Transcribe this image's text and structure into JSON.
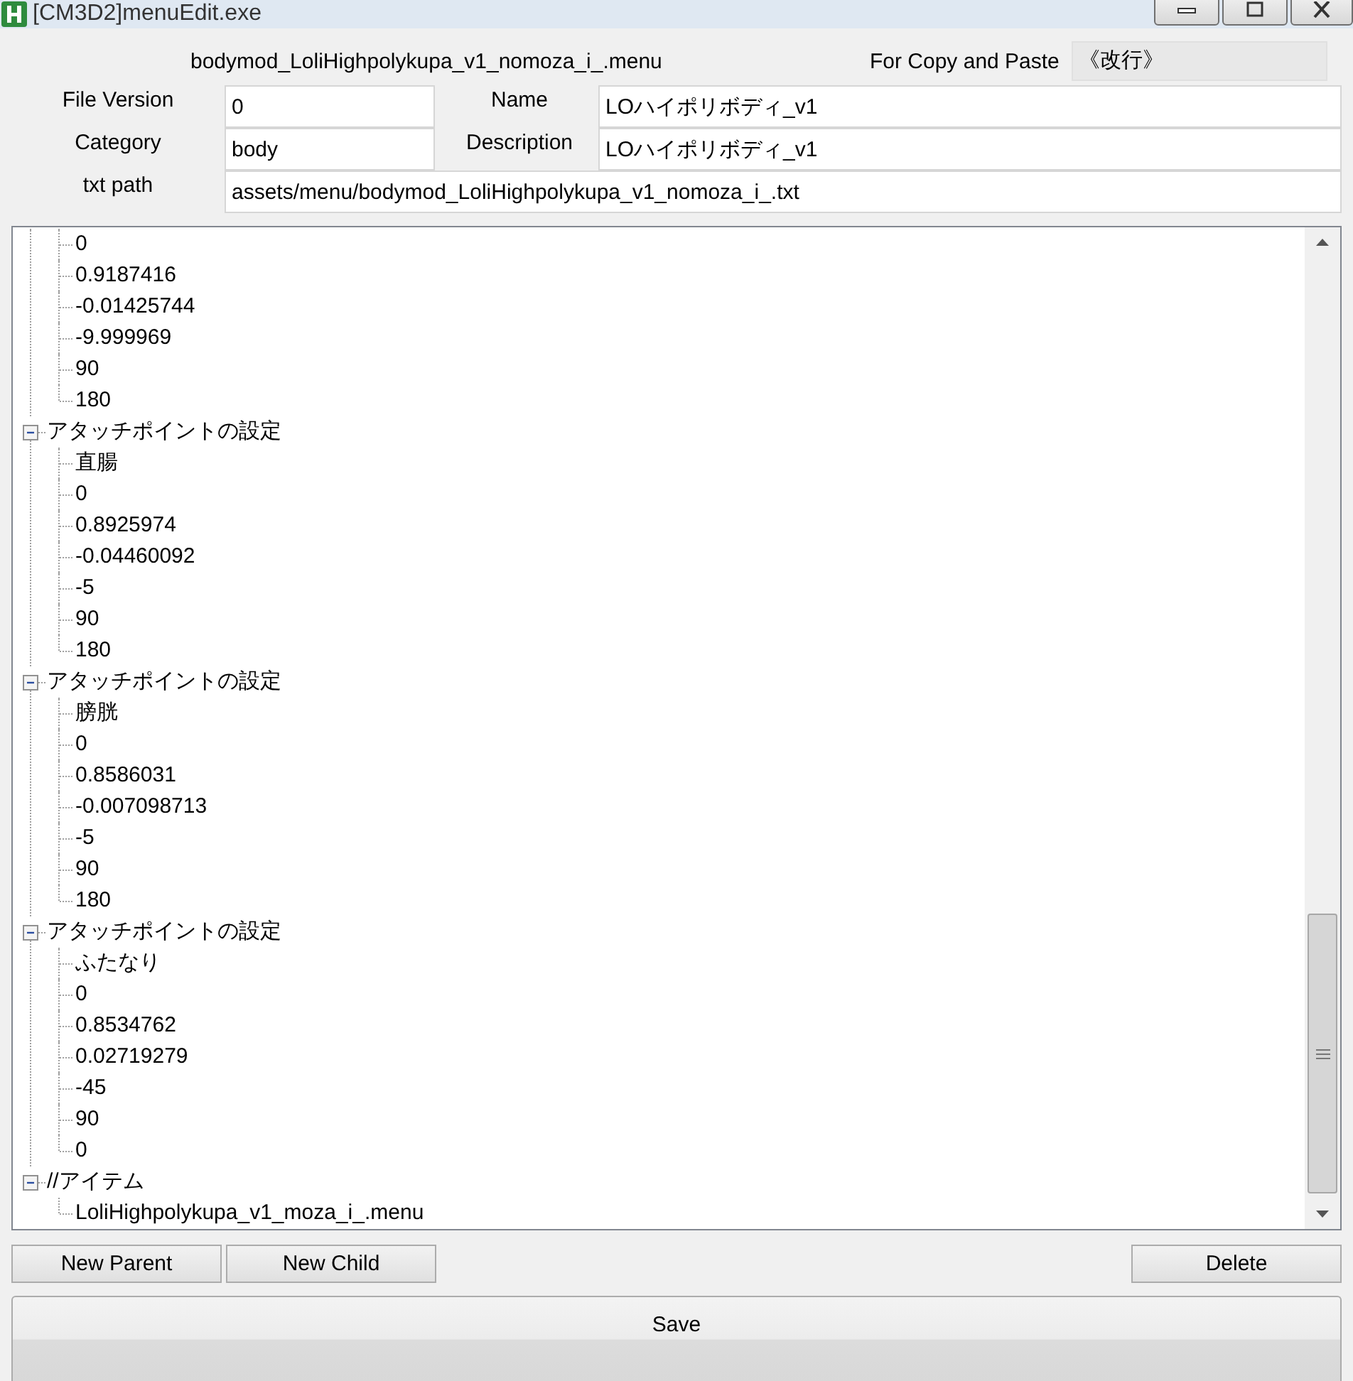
{
  "window": {
    "title": "[CM3D2]menuEdit.exe"
  },
  "header": {
    "filename": "bodymod_LoliHighpolykupa_v1_nomoza_i_.menu",
    "copy_label": "For Copy and Paste",
    "copy_value": "《改行》"
  },
  "fields": [
    {
      "label": "File Version",
      "value": "0"
    },
    {
      "label": "Name",
      "value": "LOハイポリボディ_v1"
    },
    {
      "label": "Category",
      "value": "body"
    },
    {
      "label": "Description",
      "value": "LOハイポリボディ_v1"
    },
    {
      "label": "txt path",
      "value": "assets/menu/bodymod_LoliHighpolykupa_v1_nomoza_i_.txt"
    }
  ],
  "tree": [
    {
      "children": [
        "0",
        "0.9187416",
        "-0.01425744",
        "-9.999969",
        "90",
        "180"
      ]
    },
    {
      "label": "アタッチポイントの設定",
      "expanded": true,
      "children": [
        "直腸",
        "0",
        "0.8925974",
        "-0.04460092",
        "-5",
        "90",
        "180"
      ]
    },
    {
      "label": "アタッチポイントの設定",
      "expanded": true,
      "children": [
        "膀胱",
        "0",
        "0.8586031",
        "-0.007098713",
        "-5",
        "90",
        "180"
      ]
    },
    {
      "label": "アタッチポイントの設定",
      "expanded": true,
      "children": [
        "ふたなり",
        "0",
        "0.8534762",
        "0.02719279",
        "-45",
        "90",
        "0"
      ]
    },
    {
      "label": "//アイテム",
      "expanded": true,
      "children": [
        "LoliHighpolykupa_v1_moza_i_.menu"
      ]
    }
  ],
  "buttons": [
    "New Parent",
    "New Child",
    "Delete"
  ],
  "save_button": "Save"
}
